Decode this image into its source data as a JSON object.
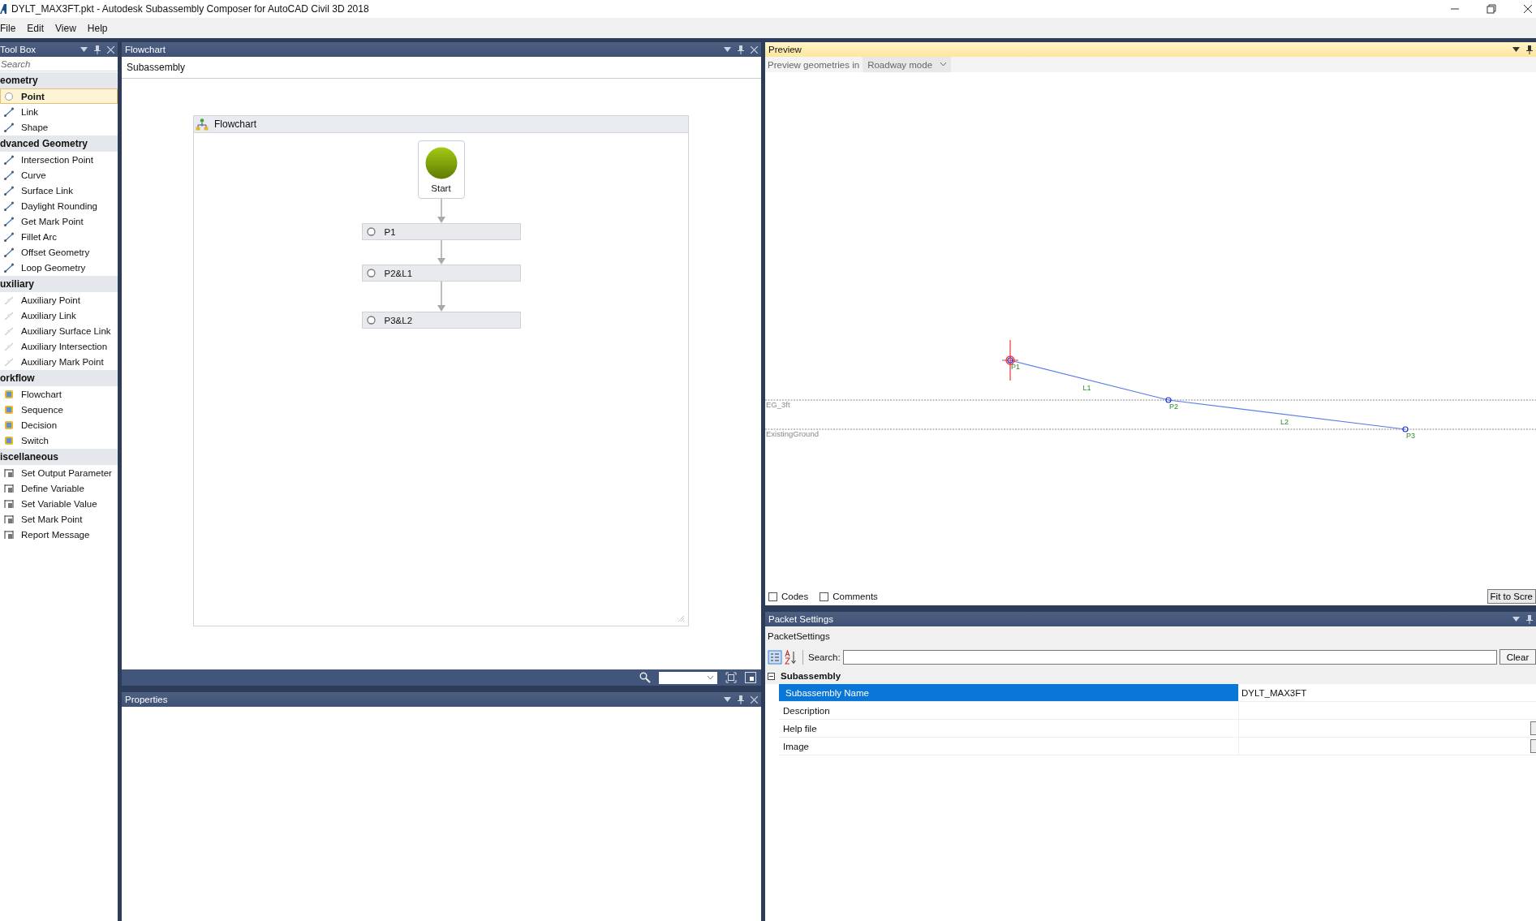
{
  "window": {
    "title": "DYLT_MAX3FT.pkt - Autodesk Subassembly Composer for AutoCAD Civil 3D 2018"
  },
  "menu": [
    "File",
    "Edit",
    "View",
    "Help"
  ],
  "toolbox": {
    "title": "Tool Box",
    "search": {
      "placeholder": "Search"
    },
    "groups": [
      {
        "name": "eometry",
        "items": [
          {
            "label": "Point",
            "selected": true
          },
          {
            "label": "Link",
            "selected": false
          },
          {
            "label": "Shape",
            "selected": false
          }
        ]
      },
      {
        "name": "dvanced Geometry",
        "items": [
          {
            "label": "Intersection Point",
            "selected": false
          },
          {
            "label": "Curve",
            "selected": false
          },
          {
            "label": "Surface Link",
            "selected": false
          },
          {
            "label": "Daylight Rounding",
            "selected": false
          },
          {
            "label": "Get Mark Point",
            "selected": false
          },
          {
            "label": "Fillet Arc",
            "selected": false
          },
          {
            "label": "Offset Geometry",
            "selected": false
          },
          {
            "label": "Loop Geometry",
            "selected": false
          }
        ]
      },
      {
        "name": "uxiliary",
        "items": [
          {
            "label": "Auxiliary Point",
            "selected": false
          },
          {
            "label": "Auxiliary Link",
            "selected": false
          },
          {
            "label": "Auxiliary Surface Link",
            "selected": false
          },
          {
            "label": "Auxiliary Intersection",
            "selected": false
          },
          {
            "label": "Auxiliary Mark Point",
            "selected": false
          }
        ]
      },
      {
        "name": "orkflow",
        "items": [
          {
            "label": "Flowchart",
            "selected": false
          },
          {
            "label": "Sequence",
            "selected": false
          },
          {
            "label": "Decision",
            "selected": false
          },
          {
            "label": "Switch",
            "selected": false
          }
        ]
      },
      {
        "name": "iscellaneous",
        "items": [
          {
            "label": "Set Output Parameter",
            "selected": false
          },
          {
            "label": "Define Variable",
            "selected": false
          },
          {
            "label": "Set Variable Value",
            "selected": false
          },
          {
            "label": "Set Mark Point",
            "selected": false
          },
          {
            "label": "Report Message",
            "selected": false
          }
        ]
      }
    ]
  },
  "flowchart_panel": {
    "title": "Flowchart",
    "breadcrumb": "Subassembly",
    "container_title": "Flowchart",
    "start": "Start",
    "steps": [
      "P1",
      "P2&L1",
      "P3&L2"
    ]
  },
  "properties_panel": {
    "title": "Properties"
  },
  "preview": {
    "title": "Preview",
    "mode_label": "Preview geometries in",
    "mode": "Roadway mode",
    "surfaces": [
      "EG_3ft",
      "ExistingGround"
    ],
    "points": [
      "P1",
      "P2",
      "P3"
    ],
    "links": [
      "L1",
      "L2"
    ],
    "checkboxes": [
      {
        "label": "Codes",
        "checked": false
      },
      {
        "label": "Comments",
        "checked": false
      }
    ],
    "fit_button": "Fit to Scre"
  },
  "packet_settings": {
    "title": "Packet Settings",
    "object": "PacketSettings",
    "search_label": "Search:",
    "clear_button": "Clear",
    "category": {
      "name": "Subassembly",
      "expanded": true
    },
    "rows": [
      {
        "name": "Subassembly Name",
        "value": "DYLT_MAX3FT",
        "selected": true,
        "browse": false
      },
      {
        "name": "Description",
        "selected": false,
        "browse": false
      },
      {
        "name": "Help file",
        "selected": false,
        "browse": true
      },
      {
        "name": "Image",
        "selected": false,
        "browse": true
      }
    ]
  }
}
